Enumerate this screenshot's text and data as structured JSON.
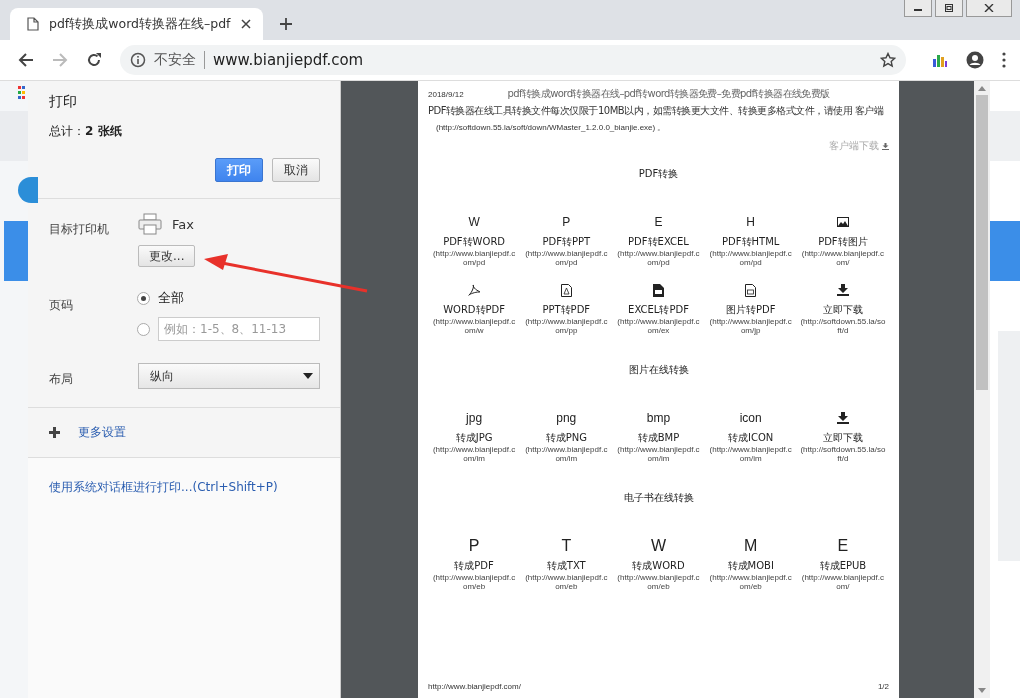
{
  "browser": {
    "tab": {
      "title": "pdf转换成word转换器在线–pdf"
    },
    "forward": {
      "disabled": true
    },
    "address": {
      "security": "不安全",
      "url": "www.bianjiepdf.com"
    }
  },
  "print_panel": {
    "title": "打印",
    "total": "总计：**2 张纸**",
    "print_button": "打印",
    "cancel_button": "取消",
    "destination": {
      "label": "目标打印机",
      "printer": "Fax",
      "change_button": "更改..."
    },
    "pages": {
      "label": "页码",
      "options": [
        {
          "kind": "all",
          "label": "全部",
          "selected": true
        },
        {
          "kind": "custom",
          "placeholder": "例如：1-5、8、11-13",
          "selected": false
        }
      ]
    },
    "layout": {
      "label": "布局",
      "value": "纵向"
    },
    "more_settings": "更多设置",
    "system_dialog_link": "使用系统对话框进行打印...(Ctrl+Shift+P)"
  },
  "preview": {
    "page": {
      "date": "2018/9/12",
      "header_title": "pdf转换成word转换器在线–pdf转word转换器免费–免费pdf转换器在线免费版",
      "notice": "PDF转换器在线工具转换文件每次仅限于10MB以内，如需转换更大文件、转换更多格式文件，请使用 客户端",
      "notice_url": "(http://softdown.55.la/soft/down/WMaster_1.2.0.0_bianjie.exe) 。",
      "client_download": "客户端下载",
      "sections": [
        {
          "title": "PDF转换",
          "rows": [
            [
              {
                "kind": "letter",
                "glyph": "W",
                "label": "PDF转WORD",
                "url": "(http://www.bianjiepdf.com/pd"
              },
              {
                "kind": "letter",
                "glyph": "P",
                "label": "PDF转PPT",
                "url": "(http://www.bianjiepdf.com/pd"
              },
              {
                "kind": "letter",
                "glyph": "E",
                "label": "PDF转EXCEL",
                "url": "(http://www.bianjiepdf.com/pd"
              },
              {
                "kind": "letter",
                "glyph": "H",
                "label": "PDF转HTML",
                "url": "(http://www.bianjiepdf.com/pd"
              },
              {
                "kind": "image",
                "label": "PDF转图片",
                "url": "(http://www.bianjiepdf.com/"
              }
            ],
            [
              {
                "kind": "acrobat",
                "label": "WORD转PDF",
                "url": "(http://www.bianjiepdf.com/w"
              },
              {
                "kind": "pdf",
                "label": "PPT转PDF",
                "url": "(http://www.bianjiepdf.com/pp"
              },
              {
                "kind": "sheet",
                "label": "EXCEL转PDF",
                "url": "(http://www.bianjiepdf.com/ex"
              },
              {
                "kind": "doc",
                "label": "图片转PDF",
                "url": "(http://www.bianjiepdf.com/jp"
              },
              {
                "kind": "download",
                "label": "立即下载",
                "url": "(http://softdown.55.la/soft/d"
              }
            ]
          ]
        },
        {
          "title": "图片在线转换",
          "rows": [
            [
              {
                "kind": "letter",
                "glyph": "jpg",
                "label": "转成JPG",
                "url": "(http://www.bianjiepdf.com/im"
              },
              {
                "kind": "letter",
                "glyph": "png",
                "label": "转成PNG",
                "url": "(http://www.bianjiepdf.com/im"
              },
              {
                "kind": "letter",
                "glyph": "bmp",
                "label": "转成BMP",
                "url": "(http://www.bianjiepdf.com/im"
              },
              {
                "kind": "letter",
                "glyph": "icon",
                "label": "转成ICON",
                "url": "(http://www.bianjiepdf.com/im"
              },
              {
                "kind": "download",
                "label": "立即下载",
                "url": "(http://softdown.55.la/soft/d"
              }
            ]
          ]
        },
        {
          "title": "电子书在线转换",
          "rows": [
            [
              {
                "kind": "big",
                "glyph": "P",
                "label": "转成PDF",
                "url": "(http://www.bianjiepdf.com/eb"
              },
              {
                "kind": "big",
                "glyph": "T",
                "label": "转成TXT",
                "url": "(http://www.bianjiepdf.com/eb"
              },
              {
                "kind": "big",
                "glyph": "W",
                "label": "转成WORD",
                "url": "(http://www.bianjiepdf.com/eb"
              },
              {
                "kind": "big",
                "glyph": "M",
                "label": "转成MOBI",
                "url": "(http://www.bianjiepdf.com/eb"
              },
              {
                "kind": "big",
                "glyph": "E",
                "label": "转成EPUB",
                "url": "(http://www.bianjiepdf.com/"
              }
            ]
          ]
        }
      ],
      "footer_url": "http://www.bianjiepdf.com/",
      "page_number": "1/2"
    }
  }
}
